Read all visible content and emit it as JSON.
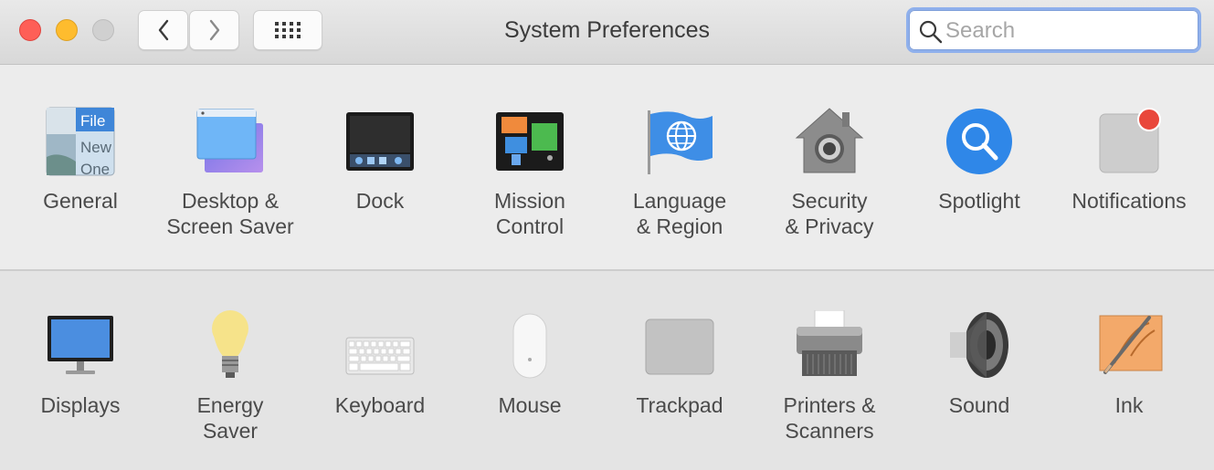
{
  "window": {
    "title": "System Preferences",
    "search_placeholder": "Search",
    "search_value": ""
  },
  "row1": [
    {
      "label": "General",
      "icon": "general-icon"
    },
    {
      "label": "Desktop &\nScreen Saver",
      "icon": "desktop-screensaver-icon"
    },
    {
      "label": "Dock",
      "icon": "dock-icon"
    },
    {
      "label": "Mission\nControl",
      "icon": "mission-control-icon"
    },
    {
      "label": "Language\n& Region",
      "icon": "language-region-icon"
    },
    {
      "label": "Security\n& Privacy",
      "icon": "security-privacy-icon"
    },
    {
      "label": "Spotlight",
      "icon": "spotlight-icon"
    },
    {
      "label": "Notifications",
      "icon": "notifications-icon"
    }
  ],
  "row2": [
    {
      "label": "Displays",
      "icon": "displays-icon"
    },
    {
      "label": "Energy\nSaver",
      "icon": "energy-saver-icon"
    },
    {
      "label": "Keyboard",
      "icon": "keyboard-icon"
    },
    {
      "label": "Mouse",
      "icon": "mouse-icon"
    },
    {
      "label": "Trackpad",
      "icon": "trackpad-icon"
    },
    {
      "label": "Printers &\nScanners",
      "icon": "printers-scanners-icon"
    },
    {
      "label": "Sound",
      "icon": "sound-icon"
    },
    {
      "label": "Ink",
      "icon": "ink-icon"
    }
  ],
  "general_icon_text": {
    "line1": "File",
    "line2": "New",
    "line3": "One"
  },
  "colors": {
    "close": "#fe5f57",
    "minimize": "#febc2e",
    "zoom_disabled": "#d0d0d0",
    "search_focus_ring": "#8fb0ec"
  }
}
